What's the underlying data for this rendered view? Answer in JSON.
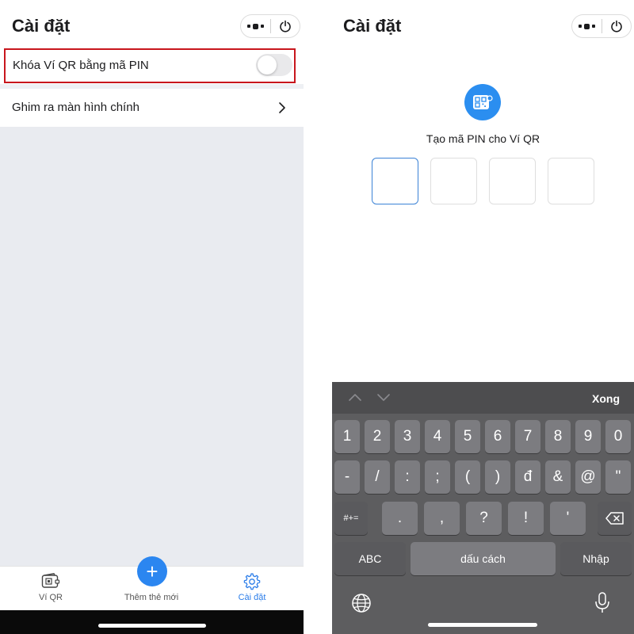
{
  "left": {
    "title": "Cài đặt",
    "settings": {
      "pin_lock_label": "Khóa Ví QR bằng mã PIN",
      "pin_lock_enabled": false,
      "pin_home_label": "Ghim ra màn hình chính"
    },
    "tabs": [
      {
        "label": "Ví QR",
        "icon": "wallet-icon",
        "active": false
      },
      {
        "label": "Thêm thẻ mới",
        "icon": "plus-icon",
        "active": false
      },
      {
        "label": "Cài đặt",
        "icon": "gear-icon",
        "active": true
      }
    ],
    "fab_symbol": "+"
  },
  "right": {
    "title": "Cài đặt",
    "pin_prompt": "Tạo mã PIN cho Ví QR",
    "pin_length": 4,
    "keyboard": {
      "done_label": "Xong",
      "row1": [
        "1",
        "2",
        "3",
        "4",
        "5",
        "6",
        "7",
        "8",
        "9",
        "0"
      ],
      "row2": [
        "-",
        "/",
        ":",
        ";",
        "(",
        ")",
        "đ",
        "&",
        "@",
        "\""
      ],
      "row3": [
        "#+=",
        ".",
        ",",
        "?",
        "!",
        "'"
      ],
      "abc_label": "ABC",
      "space_label": "dấu cách",
      "return_label": "Nhập"
    }
  },
  "colors": {
    "accent": "#2b7de9",
    "highlight_border": "#c8161d",
    "keyboard_bg": "#5d5d5f"
  }
}
